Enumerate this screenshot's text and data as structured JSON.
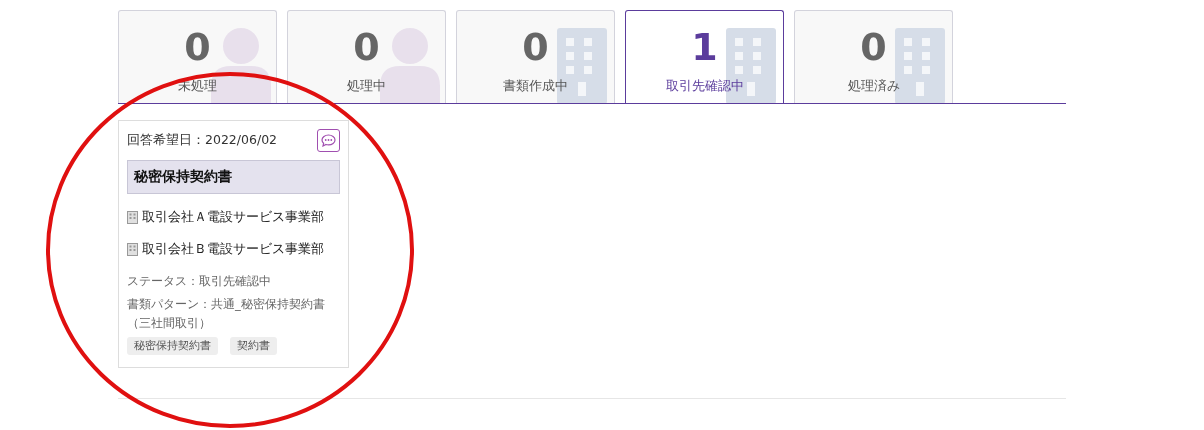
{
  "tabs": [
    {
      "count": "0",
      "label": "未処理",
      "kind": "person",
      "selected": false
    },
    {
      "count": "0",
      "label": "処理中",
      "kind": "person",
      "selected": false
    },
    {
      "count": "0",
      "label": "書類作成中",
      "kind": "building",
      "selected": false
    },
    {
      "count": "1",
      "label": "取引先確認中",
      "kind": "building",
      "selected": true
    },
    {
      "count": "0",
      "label": "処理済み",
      "kind": "building",
      "selected": false
    }
  ],
  "card": {
    "due": "回答希望日：2022/06/02",
    "title": "秘密保持契約書",
    "companies": [
      "取引会社Ａ電設サービス事業部",
      "取引会社Ｂ電設サービス事業部"
    ],
    "status": "ステータス：取引先確認中",
    "pattern": "書類パターン：共通_秘密保持契約書（三社間取引）",
    "tags": [
      "秘密保持契約書",
      "契約書"
    ]
  }
}
